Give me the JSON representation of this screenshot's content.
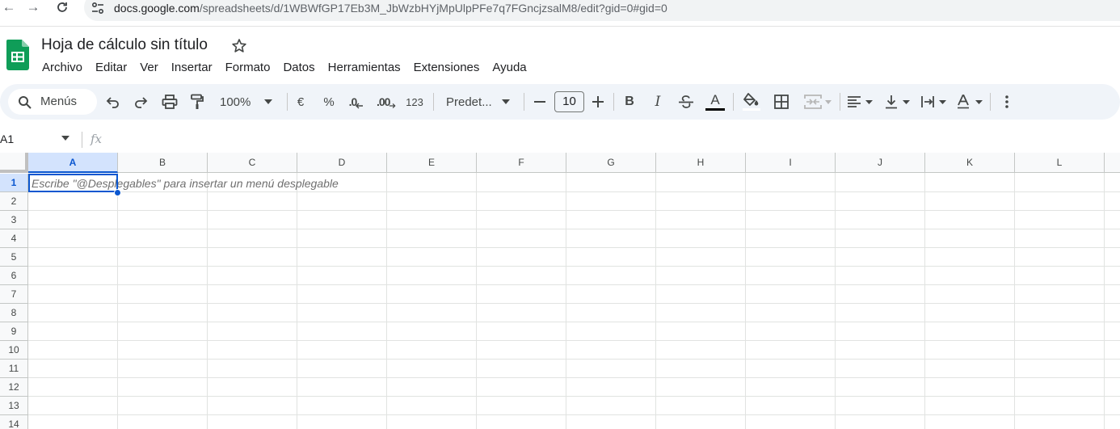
{
  "browser": {
    "url_host": "docs.google.com",
    "url_path": "/spreadsheets/d/1WBWfGP17Eb3M_JbWzbHYjMpUlpPFe7q7FGncjzsalM8/edit?gid=0#gid=0"
  },
  "app": {
    "title": "Hoja de cálculo sin título",
    "menu": [
      "Archivo",
      "Editar",
      "Ver",
      "Insertar",
      "Formato",
      "Datos",
      "Herramientas",
      "Extensiones",
      "Ayuda"
    ]
  },
  "toolbar": {
    "search_label": "Menús",
    "zoom": "100%",
    "currency": "€",
    "percent": "%",
    "decrease_decimals": ".0",
    "increase_decimals": ".00",
    "number_format": "123",
    "font": "Predet...",
    "font_size": "10",
    "bold": "B",
    "italic": "I",
    "text_color": "A"
  },
  "formula_bar": {
    "cell_ref": "A1",
    "fx": "fx"
  },
  "grid": {
    "columns": [
      "A",
      "B",
      "C",
      "D",
      "E",
      "F",
      "G",
      "H",
      "I",
      "J",
      "K",
      "L"
    ],
    "rows": [
      "1",
      "2",
      "3",
      "4",
      "5",
      "6",
      "7",
      "8",
      "9",
      "10",
      "11",
      "12",
      "13",
      "14"
    ],
    "active_cell_hint": "Escribe \"@Desplegables\" para insertar un menú desplegable"
  },
  "colors": {
    "accent": "#0b57d0",
    "sheets_green": "#0f9d58",
    "toolbar_bg": "#f0f4f9"
  }
}
